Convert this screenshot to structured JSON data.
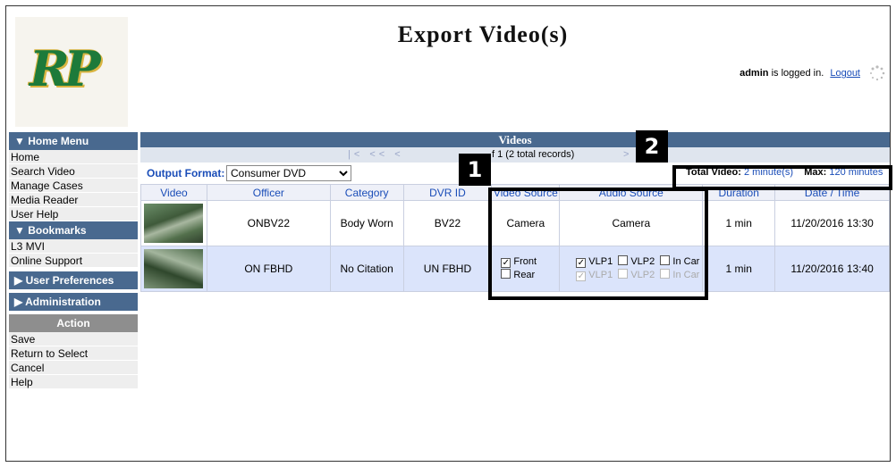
{
  "app": {
    "title": "Export Video(s)",
    "logo_text": "RP"
  },
  "login": {
    "user": "admin",
    "suffix": "is logged in.",
    "logout": "Logout"
  },
  "sidebar": {
    "home_menu": "▼ Home Menu",
    "home_items": [
      "Home",
      "Search Video",
      "Manage Cases",
      "Media Reader",
      "User Help"
    ],
    "bookmarks": "▼ Bookmarks",
    "bookmark_items": [
      "L3 MVI",
      "Online Support"
    ],
    "user_prefs": "▶ User Preferences",
    "administration": "▶ Administration",
    "action": "Action",
    "action_items": [
      "Save",
      "Return to Select",
      "Cancel",
      "Help"
    ]
  },
  "videos": {
    "header": "Videos",
    "pager_arrows": "|< << <",
    "records": "f 1 (2 total records)",
    "pager_next": ">",
    "output_format_label": "Output Format:",
    "output_format_value": "Consumer DVD",
    "total_label": "Total Video:",
    "total_value": "2 minute(s)",
    "max_label": "Max:",
    "max_value": "120 minutes",
    "columns": [
      "Video",
      "Officer",
      "Category",
      "DVR ID",
      "Video Source",
      "Audio Source",
      "Duration",
      "Date / Time"
    ],
    "rows": [
      {
        "officer": "ONBV22",
        "category": "Body Worn",
        "dvr_id": "BV22",
        "video_source": "Camera",
        "audio_source": "Camera",
        "duration": "1 min",
        "datetime": "11/20/2016 13:30"
      },
      {
        "officer": "ON FBHD",
        "category": "No Citation",
        "dvr_id": "UN FBHD",
        "front": "Front",
        "rear": "Rear",
        "vlp1": "VLP1",
        "vlp2": "VLP2",
        "incar": "In Car",
        "duration": "1 min",
        "datetime": "11/20/2016 13:40"
      }
    ]
  },
  "callouts": {
    "one": "1",
    "two": "2"
  }
}
